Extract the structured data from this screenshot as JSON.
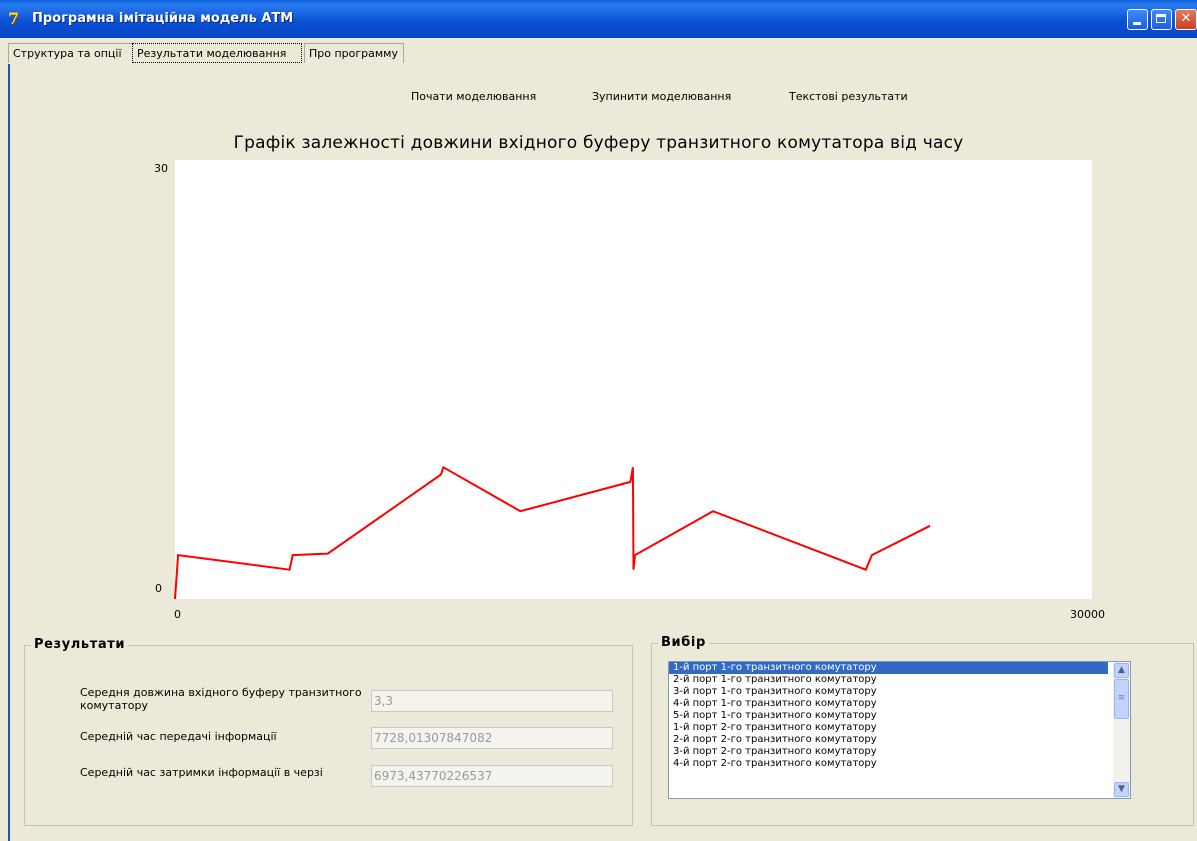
{
  "window": {
    "title": "Програмна імітаційна модель АТМ",
    "icon": "app-logo-icon"
  },
  "tabs": [
    {
      "label": "Структура та опції",
      "active": false
    },
    {
      "label": "Результати моделювання",
      "active": true
    },
    {
      "label": "Про программу",
      "active": false
    }
  ],
  "toolbar": {
    "start_label": "Почати моделювання",
    "stop_label": "Зупинити моделювання",
    "text_results_label": "Текстові результати"
  },
  "chart_data": {
    "type": "line",
    "title": "Графік залежності довжини вхідного буферу транзитного комутатора від часу",
    "xlim": [
      0,
      30000
    ],
    "ylim": [
      0,
      30
    ],
    "x_tick_labels": [
      "0",
      "30000"
    ],
    "y_tick_labels": [
      "0",
      "30"
    ],
    "grid": false,
    "series": [
      {
        "color": "#ff0000",
        "points": [
          [
            0,
            0
          ],
          [
            100,
            3.0
          ],
          [
            3750,
            2.0
          ],
          [
            3850,
            3.0
          ],
          [
            5000,
            3.1
          ],
          [
            8700,
            8.5
          ],
          [
            8780,
            9.0
          ],
          [
            11300,
            6.0
          ],
          [
            14900,
            8.0
          ],
          [
            14980,
            9.0
          ],
          [
            15000,
            2.0
          ],
          [
            15050,
            3.0
          ],
          [
            17600,
            6.0
          ],
          [
            22600,
            2.0
          ],
          [
            22800,
            3.0
          ],
          [
            24700,
            5.0
          ]
        ]
      }
    ]
  },
  "results": {
    "group_title": "Результати",
    "fields": [
      {
        "label": "Середня довжина вхідного буферу транзитного комутатору",
        "value": "3,3"
      },
      {
        "label": "Середній час передачі інформації",
        "value": "7728,01307847082"
      },
      {
        "label": "Середній час затримки інформації в черзі",
        "value": "6973,43770226537"
      }
    ]
  },
  "selection": {
    "group_title": "Вибір",
    "items": [
      "1-й порт 1-го транзитного комутатору",
      "2-й порт 1-го транзитного комутатору",
      "3-й порт 1-го транзитного комутатору",
      "4-й порт 1-го транзитного комутатору",
      "5-й порт 1-го транзитного комутатору",
      "1-й порт 2-го транзитного комутатору",
      "2-й порт 2-го транзитного комутатору",
      "3-й порт 2-го транзитного комутатору",
      "4-й порт 2-го транзитного комутатору"
    ],
    "selected_index": 0
  },
  "colors": {
    "titlebar": "#0b52d6",
    "line": "#ff0000",
    "selection": "#316ac5"
  }
}
